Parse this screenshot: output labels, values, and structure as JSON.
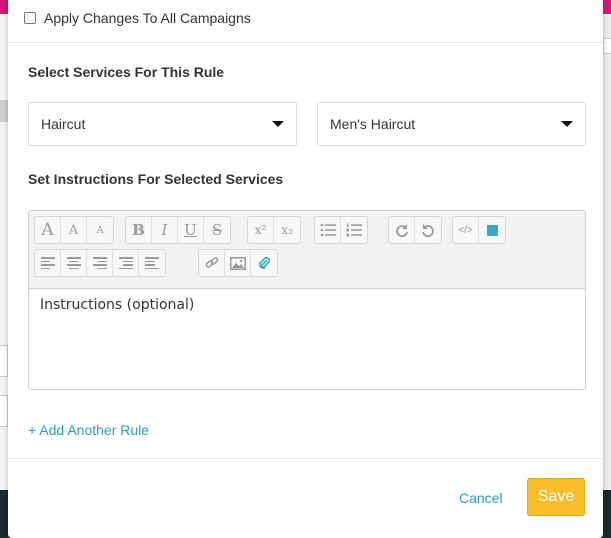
{
  "modal": {
    "apply_all_label": "Apply Changes To All Campaigns",
    "services_title": "Select Services For This Rule",
    "service_category": "Haircut",
    "service_item": "Men's Haircut",
    "instructions_title": "Set Instructions For Selected Services",
    "instructions_placeholder": "Instructions (optional)",
    "add_rule_label": "+ Add Another Rule",
    "cancel_label": "Cancel",
    "save_label": "Save"
  },
  "toolbar": {
    "font_large": "A",
    "font_medium": "A",
    "font_small": "A",
    "bold": "B",
    "italic": "I",
    "underline": "U",
    "strike": "S",
    "superscript": "x²",
    "subscript": "x₂",
    "code": "</>"
  },
  "colors": {
    "accent": "#2a9dc2",
    "save_button": "#f7bd2b",
    "color_swatch": "#3aa6c8"
  }
}
